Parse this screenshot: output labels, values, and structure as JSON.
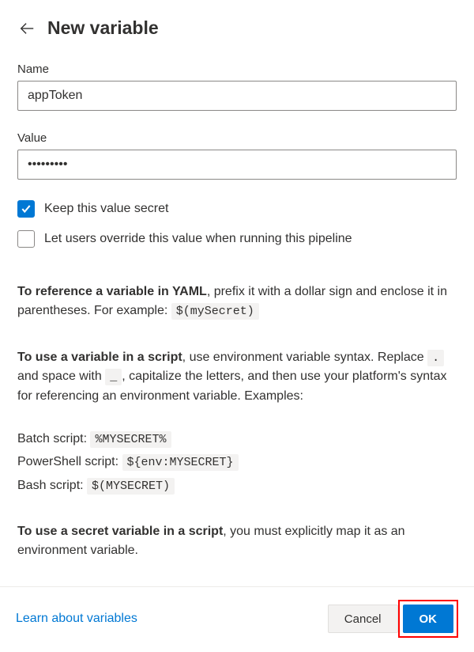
{
  "header": {
    "title": "New variable"
  },
  "fields": {
    "name": {
      "label": "Name",
      "value": "appToken"
    },
    "value": {
      "label": "Value",
      "value": "•••••••••"
    }
  },
  "checkboxes": {
    "secret": {
      "label": "Keep this value secret",
      "checked": true
    },
    "override": {
      "label": "Let users override this value when running this pipeline",
      "checked": false
    }
  },
  "help": {
    "yaml_bold": "To reference a variable in YAML",
    "yaml_text1": ", prefix it with a dollar sign and enclose it in parentheses. For example: ",
    "yaml_code": "$(mySecret)",
    "script_bold": "To use a variable in a script",
    "script_text1": ", use environment variable syntax. Replace ",
    "script_code_dot": ".",
    "script_text2": " and space with ",
    "script_code_underscore": "_",
    "script_text3": ", capitalize the letters, and then use your platform's syntax for referencing an environment variable. Examples:",
    "batch_label": "Batch script: ",
    "batch_code": "%MYSECRET%",
    "ps_label": "PowerShell script: ",
    "ps_code": "${env:MYSECRET}",
    "bash_label": "Bash script: ",
    "bash_code": "$(MYSECRET)",
    "secret_bold": "To use a secret variable in a script",
    "secret_text": ", you must explicitly map it as an environment variable."
  },
  "footer": {
    "learn_link": "Learn about variables",
    "cancel": "Cancel",
    "ok": "OK"
  }
}
